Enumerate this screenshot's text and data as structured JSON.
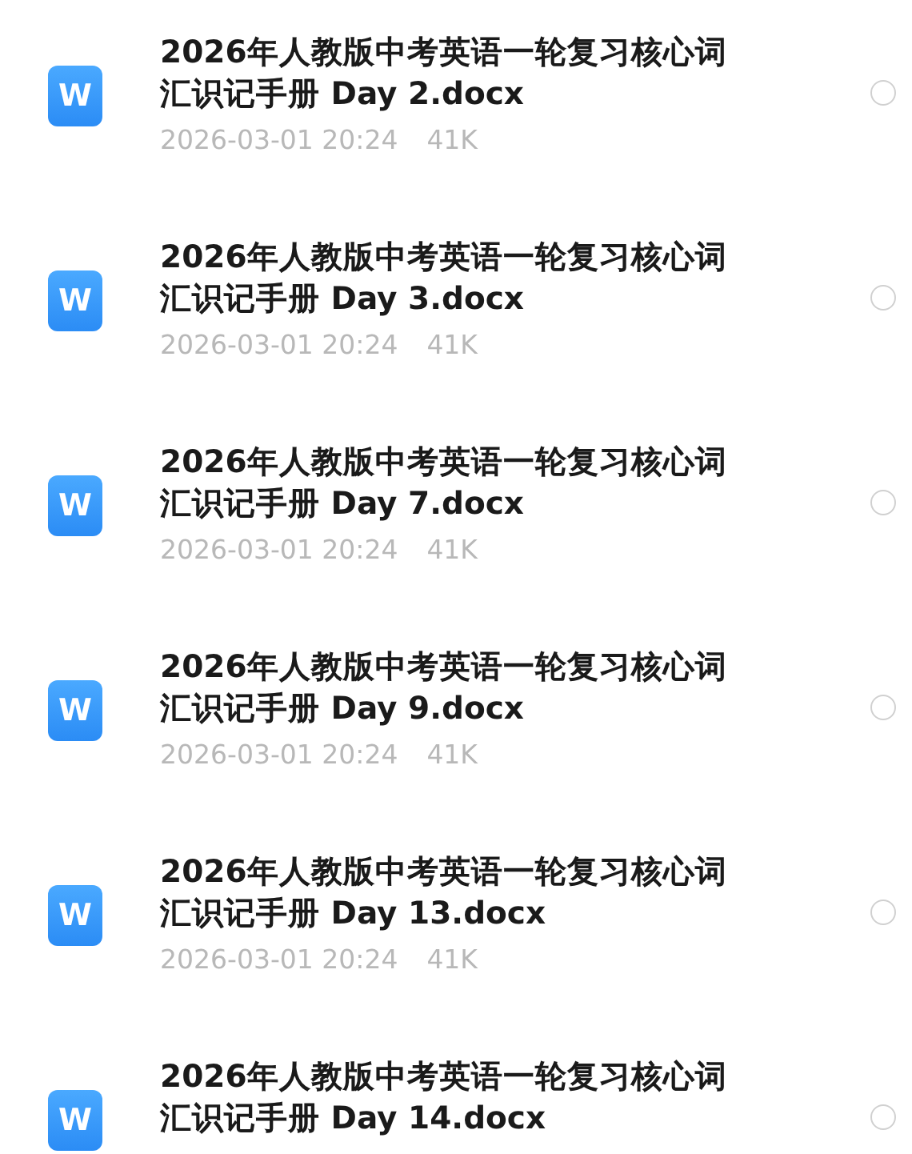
{
  "files": [
    {
      "icon_label": "W",
      "name": "2026年人教版中考英语一轮复习核心词汇识记手册 Day 2.docx",
      "date": "2026-03-01 20:24",
      "size": "41K",
      "selected": false
    },
    {
      "icon_label": "W",
      "name": "2026年人教版中考英语一轮复习核心词汇识记手册 Day 3.docx",
      "date": "2026-03-01 20:24",
      "size": "41K",
      "selected": false
    },
    {
      "icon_label": "W",
      "name": "2026年人教版中考英语一轮复习核心词汇识记手册 Day 7.docx",
      "date": "2026-03-01 20:24",
      "size": "41K",
      "selected": false
    },
    {
      "icon_label": "W",
      "name": "2026年人教版中考英语一轮复习核心词汇识记手册 Day 9.docx",
      "date": "2026-03-01 20:24",
      "size": "41K",
      "selected": false
    },
    {
      "icon_label": "W",
      "name": "2026年人教版中考英语一轮复习核心词汇识记手册 Day 13.docx",
      "date": "2026-03-01 20:24",
      "size": "41K",
      "selected": false
    },
    {
      "icon_label": "W",
      "name": "2026年人教版中考英语一轮复习核心词汇识记手册 Day 14.docx",
      "selected": false
    }
  ]
}
